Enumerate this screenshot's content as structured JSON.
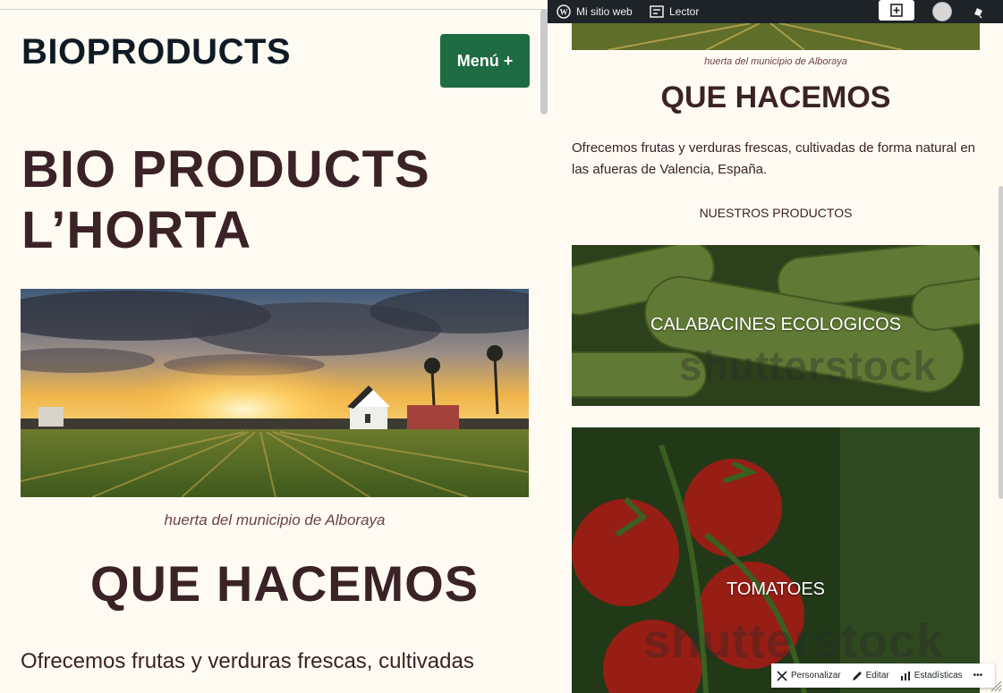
{
  "site": {
    "title": "BIOPRODUCTS",
    "menu_label": "Menú +"
  },
  "hero": {
    "title_line1": "BIO PRODUCTS",
    "title_line2": "L’HORTA"
  },
  "image_caption": "huerta del municipio de Alboraya",
  "section": {
    "heading": "QUE HACEMOS",
    "paragraph_line1": "Ofrecemos frutas y verduras frescas, cultivadas",
    "paragraph_full": "Ofrecemos frutas y verduras frescas, cultivadas de forma natural en las afueras de Valencia, España."
  },
  "products": {
    "heading": "NUESTROS PRODUCTOS",
    "items": [
      {
        "label": "CALABACINES ECOLOGICOS",
        "watermark": "shutterstock"
      },
      {
        "label": "TOMATOES",
        "watermark": "shutterstock"
      }
    ]
  },
  "admin_bar": {
    "site_link": "Mi sitio web",
    "reader_link": "Lector"
  },
  "edit_bar": {
    "customize": "Personalizar",
    "edit": "Editar",
    "stats": "Estadísticas",
    "more": "•••"
  },
  "colors": {
    "accent_button": "#1f6b42",
    "heading": "#3b2226",
    "background": "#fffbf3",
    "admin_bar": "#1d2327"
  }
}
